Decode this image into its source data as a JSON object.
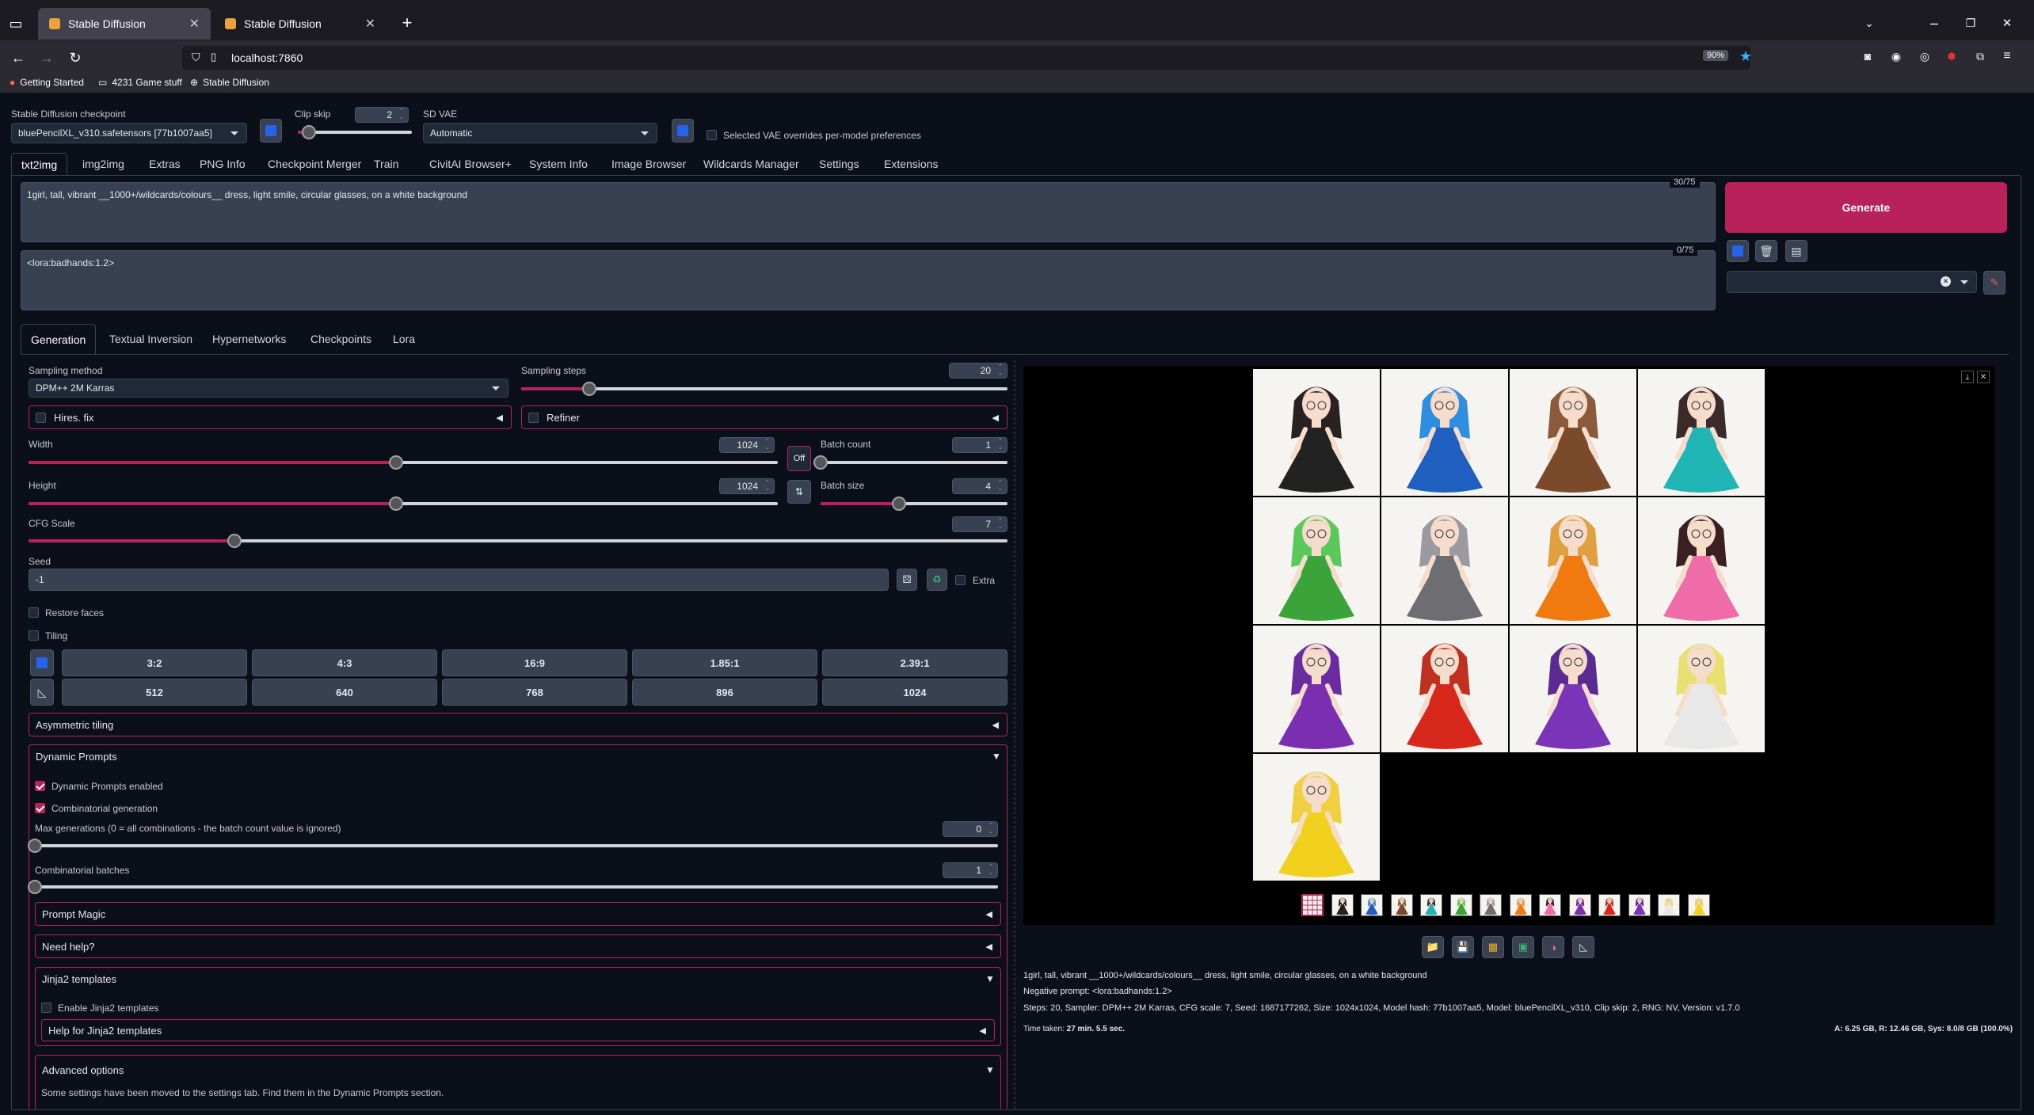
{
  "browser": {
    "tabs": [
      {
        "label": "Stable Diffusion",
        "active": true
      },
      {
        "label": "Stable Diffusion",
        "active": false
      }
    ],
    "url": "localhost:7860",
    "zoom": "90%",
    "bookmarks": [
      "Getting Started",
      "4231 Game stuff",
      "Stable Diffusion"
    ]
  },
  "top": {
    "checkpoint_label": "Stable Diffusion checkpoint",
    "checkpoint_value": "bluePencilXL_v310.safetensors [77b1007aa5]",
    "clip_skip_label": "Clip skip",
    "clip_skip_value": "2",
    "clip_skip_fraction": 0.1,
    "sd_vae_label": "SD VAE",
    "sd_vae_value": "Automatic",
    "vae_override_label": "Selected VAE overrides per-model preferences"
  },
  "main_tabs": [
    "txt2img",
    "img2img",
    "Extras",
    "PNG Info",
    "Checkpoint Merger",
    "Train",
    "CivitAI Browser+",
    "System Info",
    "Image Browser",
    "Wildcards Manager",
    "Settings",
    "Extensions"
  ],
  "prompt": {
    "positive": "1girl, tall, vibrant __1000+/wildcards/colours__ dress, light smile, circular glasses, on a white background",
    "positive_count": "30/75",
    "negative": "<lora:badhands:1.2>",
    "negative_count": "0/75",
    "generate_label": "Generate"
  },
  "sub_tabs": [
    "Generation",
    "Textual Inversion",
    "Hypernetworks",
    "Checkpoints",
    "Lora"
  ],
  "generation": {
    "sampling_method_label": "Sampling method",
    "sampling_method_value": "DPM++ 2M Karras",
    "sampling_steps_label": "Sampling steps",
    "sampling_steps_value": "20",
    "sampling_steps_fraction": 0.14,
    "hires_label": "Hires. fix",
    "refiner_label": "Refiner",
    "width_label": "Width",
    "width_value": "1024",
    "width_fraction": 0.49,
    "height_label": "Height",
    "height_value": "1024",
    "height_fraction": 0.49,
    "off_label": "Off",
    "batch_count_label": "Batch count",
    "batch_count_value": "1",
    "batch_count_fraction": 0.0,
    "batch_size_label": "Batch size",
    "batch_size_value": "4",
    "batch_size_fraction": 0.42,
    "cfg_label": "CFG Scale",
    "cfg_value": "7",
    "cfg_fraction": 0.21,
    "seed_label": "Seed",
    "seed_value": "-1",
    "extra_label": "Extra",
    "restore_faces_label": "Restore faces",
    "tiling_label": "Tiling",
    "ratios": [
      "3:2",
      "4:3",
      "16:9",
      "1.85:1",
      "2.39:1"
    ],
    "sizes": [
      "512",
      "640",
      "768",
      "896",
      "1024"
    ],
    "asymmetric_tiling_label": "Asymmetric tiling"
  },
  "dynamic_prompts": {
    "title": "Dynamic Prompts",
    "enabled_label": "Dynamic Prompts enabled",
    "combinatorial_label": "Combinatorial generation",
    "max_gen_label": "Max generations (0 = all combinations - the batch count value is ignored)",
    "max_gen_value": "0",
    "comb_batches_label": "Combinatorial batches",
    "comb_batches_value": "1",
    "prompt_magic_label": "Prompt Magic",
    "need_help_label": "Need help?",
    "jinja_label": "Jinja2 templates",
    "enable_jinja_label": "Enable Jinja2 templates",
    "help_jinja_label": "Help for Jinja2 templates",
    "advanced_label": "Advanced options",
    "advanced_note": "Some settings have been moved to the settings tab. Find them in the Dynamic Prompts section."
  },
  "output": {
    "dress_colors": [
      "#222222",
      "#1f5fbf",
      "#7a4a2a",
      "#1fb5b5",
      "#3aa43a",
      "#6e6e72",
      "#f07a10",
      "#f06ca8",
      "#7b2fb0",
      "#d8281e",
      "#7a34b8",
      "#e8e8e8",
      "#f2d01e"
    ],
    "hair_colors": [
      "#2a2222",
      "#2f8ee0",
      "#8a5a3a",
      "#3a2a2a",
      "#5bc85b",
      "#9a9aa0",
      "#e0a040",
      "#3a2020",
      "#6a2aa0",
      "#c03020",
      "#5a2a90",
      "#e8e070",
      "#f0d040"
    ],
    "info_line1": "1girl, tall, vibrant __1000+/wildcards/colours__ dress, light smile, circular glasses, on a white background",
    "info_line2": "Negative prompt: <lora:badhands:1.2>",
    "info_line3": "Steps: 20, Sampler: DPM++ 2M Karras, CFG scale: 7, Seed: 1687177262, Size: 1024x1024, Model hash: 77b1007aa5, Model: bluePencilXL_v310, Clip skip: 2, RNG: NV, Version: v1.7.0",
    "time_label": "Time taken:",
    "time_value": "27 min. 5.5 sec.",
    "vram": "A: 6.25 GB, R: 12.46 GB, Sys: 8.0/8 GB (100.0%)"
  }
}
